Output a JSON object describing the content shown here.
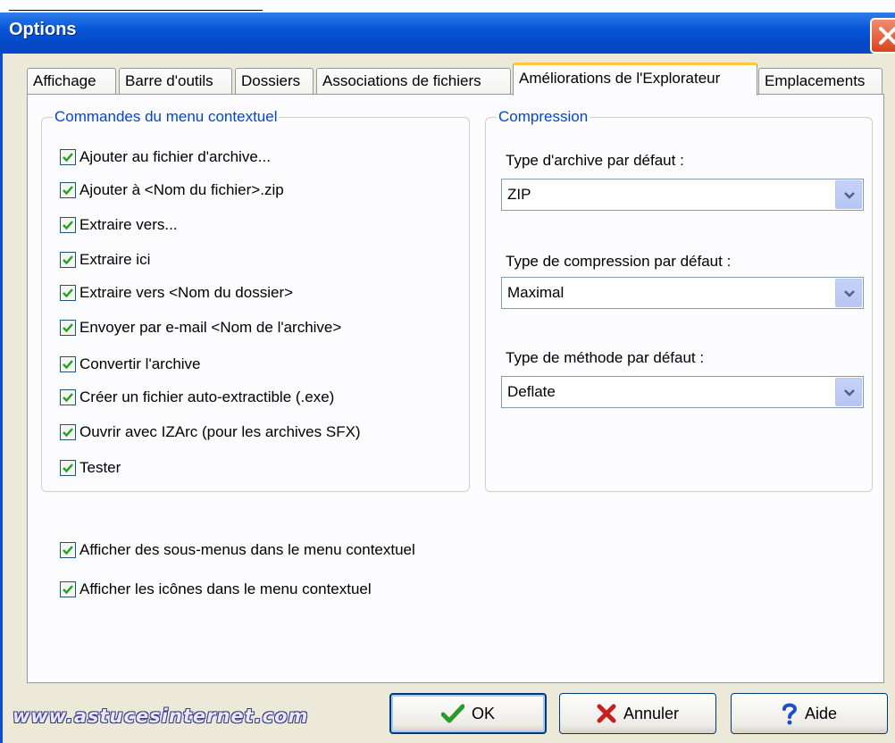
{
  "window": {
    "title": "Options",
    "close_icon": "close-icon"
  },
  "tabs": [
    {
      "label": "Affichage",
      "active": false
    },
    {
      "label": "Barre d'outils",
      "active": false
    },
    {
      "label": "Dossiers",
      "active": false
    },
    {
      "label": "Associations de fichiers",
      "active": false
    },
    {
      "label": "Améliorations de l'Explorateur",
      "active": true
    },
    {
      "label": "Emplacements",
      "active": false
    }
  ],
  "context_menu_group": {
    "title": "Commandes du menu contextuel",
    "items": [
      {
        "label": "Ajouter au fichier d'archive...",
        "checked": true
      },
      {
        "label": "Ajouter à <Nom du fichier>.zip",
        "checked": true
      },
      {
        "label": "Extraire vers...",
        "checked": true
      },
      {
        "label": "Extraire ici",
        "checked": true
      },
      {
        "label": "Extraire vers <Nom du dossier>",
        "checked": true
      },
      {
        "label": "Envoyer par e-mail <Nom de l'archive>",
        "checked": true
      },
      {
        "label": "Convertir l'archive",
        "checked": true
      },
      {
        "label": "Créer un fichier auto-extractible (.exe)",
        "checked": true
      },
      {
        "label": "Ouvrir avec IZArc (pour les archives SFX)",
        "checked": true
      },
      {
        "label": "Tester",
        "checked": true
      }
    ]
  },
  "compression_group": {
    "title": "Compression",
    "archive_type": {
      "label": "Type d'archive par défaut :",
      "value": "ZIP"
    },
    "compression_type": {
      "label": "Type de compression par défaut :",
      "value": "Maximal"
    },
    "method_type": {
      "label": "Type de méthode par défaut :",
      "value": "Deflate"
    }
  },
  "extra_options": [
    {
      "label": "Afficher des sous-menus dans le menu contextuel",
      "checked": true
    },
    {
      "label": "Afficher les icônes dans le menu contextuel",
      "checked": true
    }
  ],
  "buttons": {
    "ok": "OK",
    "cancel": "Annuler",
    "help": "Aide"
  },
  "watermark": "www.astucesinternet.com",
  "colors": {
    "titlebar": "#0a4fd0",
    "group_title": "#0046d5",
    "active_tab_accent": "#ffc83c",
    "ok_check": "#2a9a2a",
    "cancel_x": "#c81e1e",
    "help_mark": "#1f4fc8"
  }
}
